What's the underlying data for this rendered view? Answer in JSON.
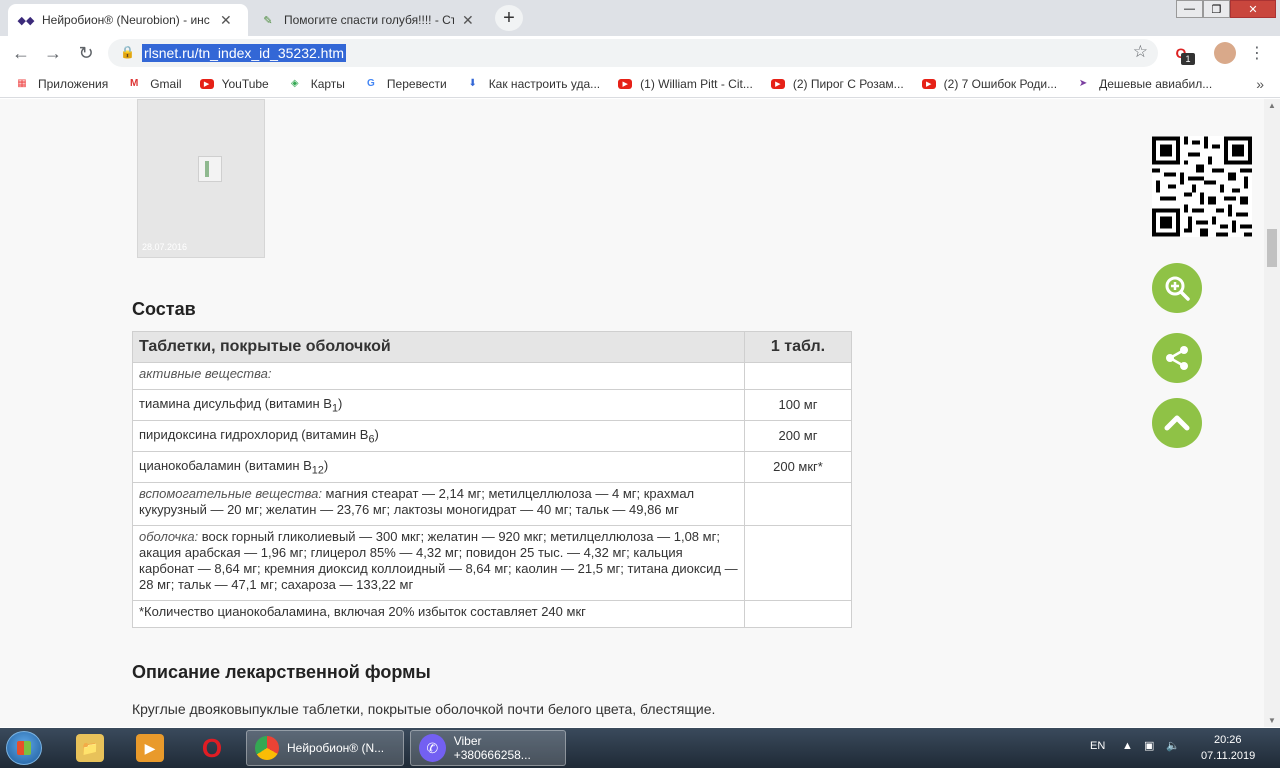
{
  "browser": {
    "tabs": [
      {
        "title": "Нейробион® (Neurobion) - инс"
      },
      {
        "title": "Помогите спасти голубя!!!! - Стр"
      }
    ],
    "url": "rlsnet.ru/tn_index_id_35232.htm",
    "extension_badge": "1"
  },
  "bookmarks": [
    {
      "label": "Приложения",
      "icon": "apps-grid-icon"
    },
    {
      "label": "Gmail",
      "icon": "gmail-icon"
    },
    {
      "label": "YouTube",
      "icon": "youtube-icon"
    },
    {
      "label": "Карты",
      "icon": "maps-icon"
    },
    {
      "label": "Перевести",
      "icon": "translate-icon"
    },
    {
      "label": "Как настроить уда...",
      "icon": "download-arrow-icon"
    },
    {
      "label": "(1) William Pitt - Cit...",
      "icon": "youtube-icon"
    },
    {
      "label": "(2) Пирог С Розам...",
      "icon": "youtube-icon"
    },
    {
      "label": "(2) 7 Ошибок Роди...",
      "icon": "youtube-icon"
    },
    {
      "label": "Дешевые авиабил...",
      "icon": "plane-icon"
    }
  ],
  "page": {
    "photo_date": "28.07.2016",
    "composition_title": "Состав",
    "table": {
      "header_left": "Таблетки, покрытые оболочкой",
      "header_right": "1 табл.",
      "active_label": "активные вещества:",
      "rows": [
        {
          "name": "тиамина дисульфид (витамин B",
          "sub": "1",
          "tail": ")",
          "value": "100 мг"
        },
        {
          "name": "пиридоксина гидрохлорид (витамин B",
          "sub": "6",
          "tail": ")",
          "value": "200 мг"
        },
        {
          "name": "цианокобаламин (витамин B",
          "sub": "12",
          "tail": ")",
          "value": "200 мкг*"
        }
      ],
      "excipients_label": "вспомогательные вещества:",
      "excipients_text": " магния стеарат — 2,14 мг; метилцеллюлоза — 4 мг; крахмал кукурузный — 20 мг; желатин — 23,76 мг; лактозы моногидрат — 40 мг; тальк — 49,86 мг",
      "coating_label": "оболочка:",
      "coating_text": " воск горный гликолиевый — 300 мкг; желатин — 920 мкг; метилцеллюлоза — 1,08 мг; акация арабская — 1,96 мг; глицерол 85% — 4,32 мг; повидон 25 тыс. — 4,32 мг; кальция карбонат — 8,64 мг; кремния диоксид коллоидный — 8,64 мг; каолин — 21,5 мг; титана диоксид — 28 мг; тальк — 47,1 мг; сахароза — 133,22 мг",
      "footnote": "*Количество цианокобаламина, включая 20% избыток составляет 240 мкг"
    },
    "form_title": "Описание лекарственной формы",
    "form_text": "Круглые двояковыпуклые таблетки, покрытые оболочкой почти белого цвета, блестящие."
  },
  "taskbar": {
    "chrome_label": "Нейробион® (N...",
    "viber_label": "Viber +380666258...",
    "lang": "EN",
    "time": "20:26",
    "date": "07.11.2019"
  },
  "colors": {
    "accent_green": "#8fc246",
    "url_highlight": "#3367d6"
  }
}
